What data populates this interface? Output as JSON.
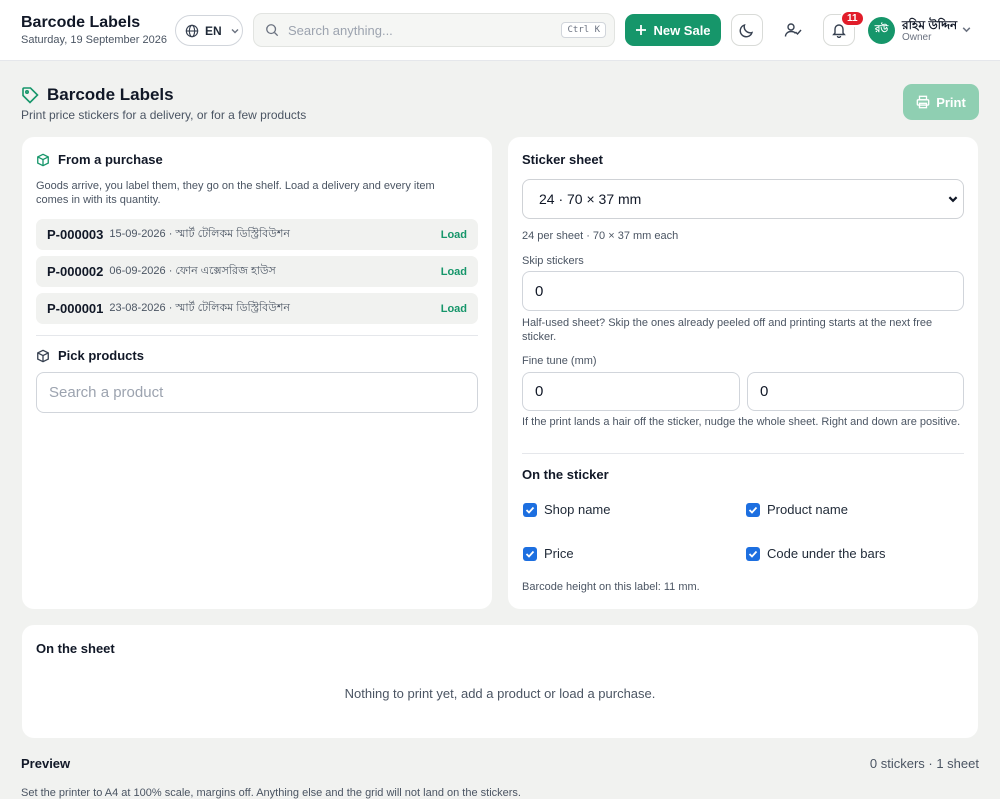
{
  "header": {
    "app_title": "Barcode Labels",
    "date": "Saturday, 19 September 2026",
    "language": "EN",
    "search_placeholder": "Search anything...",
    "search_shortcut": "Ctrl K",
    "new_sale_label": "New Sale",
    "notification_count": "11",
    "user_initials": "রউ",
    "user_name": "রহিম উদ্দিন",
    "user_role": "Owner"
  },
  "page": {
    "title": "Barcode Labels",
    "subtitle": "Print price stickers for a delivery, or for a few products",
    "print_label": "Print"
  },
  "from_purchase": {
    "title": "From a purchase",
    "description": "Goods arrive, you label them, they go on the shelf. Load a delivery and every item comes in with its quantity.",
    "purchases": [
      {
        "code": "P-000003",
        "meta": "15-09-2026 · স্মার্ট টেলিকম ডিস্ট্রিবিউশন",
        "action": "Load"
      },
      {
        "code": "P-000002",
        "meta": "06-09-2026 · ফোন এক্সেসরিজ হাউস",
        "action": "Load"
      },
      {
        "code": "P-000001",
        "meta": "23-08-2026 · স্মার্ট টেলিকম ডিস্ট্রিবিউশন",
        "action": "Load"
      }
    ]
  },
  "pick_products": {
    "title": "Pick products",
    "search_placeholder": "Search a product"
  },
  "sticker_sheet": {
    "title": "Sticker sheet",
    "selected": "24 · 70 × 37 mm",
    "info": "24 per sheet · 70 × 37 mm each",
    "skip_label": "Skip stickers",
    "skip_value": "0",
    "skip_help": "Half-used sheet? Skip the ones already peeled off and printing starts at the next free sticker.",
    "fine_tune_label": "Fine tune (mm)",
    "fine_tune_x": "0",
    "fine_tune_y": "0",
    "fine_tune_help": "If the print lands a hair off the sticker, nudge the whole sheet. Right and down are positive.",
    "on_sticker_title": "On the sticker",
    "options": {
      "shop_name": "Shop name",
      "product_name": "Product name",
      "price": "Price",
      "code_under_bars": "Code under the bars"
    },
    "barcode_note": "Barcode height on this label: 11 mm."
  },
  "on_the_sheet": {
    "title": "On the sheet",
    "empty": "Nothing to print yet, add a product or load a purchase."
  },
  "preview": {
    "title": "Preview",
    "count": "0 stickers · 1 sheet",
    "note": "Set the printer to A4 at 100% scale, margins off. Anything else and the grid will not land on the stickers."
  },
  "colors": {
    "accent": "#16966a",
    "print_disabled": "#8fcfb2",
    "checkbox": "#1d6fe0",
    "badge": "#e11d2a"
  }
}
